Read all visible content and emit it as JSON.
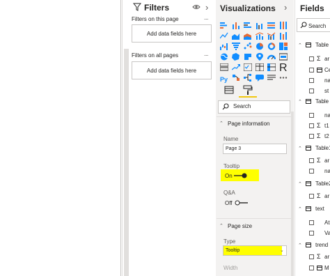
{
  "filters": {
    "title": "Filters",
    "page_section": "Filters on this page",
    "page_well": "Add data fields here",
    "all_section": "Filters on all pages",
    "all_well": "Add data fields here",
    "more": "...",
    "collapse": "›"
  },
  "visualizations": {
    "title": "Visualizations",
    "collapse": "›",
    "search_placeholder": "Search",
    "icon_letters": [
      "R",
      "Py"
    ],
    "page_information": {
      "header": "Page information",
      "name_label": "Name",
      "name_value": "Page 3",
      "tooltip_label": "Tooltip",
      "tooltip_value": "On",
      "qa_label": "Q&A",
      "qa_value": "Off"
    },
    "page_size": {
      "header": "Page size",
      "type_label": "Type",
      "type_value": "Tooltip",
      "width_label": "Width"
    },
    "colors": {
      "accent": "#f2c811",
      "highlight": "#ffff00"
    }
  },
  "fields": {
    "title": "Fields",
    "search_placeholder": "Search",
    "items": [
      {
        "text": "Table",
        "kind": "table"
      },
      {
        "text": "ar",
        "kind": "sigma"
      },
      {
        "text": "Ce",
        "kind": "calc"
      },
      {
        "text": "na",
        "kind": "field"
      },
      {
        "text": "st",
        "kind": "field"
      },
      {
        "text": "Table",
        "kind": "table"
      },
      {
        "text": "na",
        "kind": "field"
      },
      {
        "text": "t1",
        "kind": "sigma"
      },
      {
        "text": "t2",
        "kind": "sigma"
      },
      {
        "text": "Table1",
        "kind": "table"
      },
      {
        "text": "ar",
        "kind": "sigma"
      },
      {
        "text": "na",
        "kind": "field"
      },
      {
        "text": "Table2",
        "kind": "table"
      },
      {
        "text": "ar",
        "kind": "sigma"
      },
      {
        "text": "text",
        "kind": "table"
      },
      {
        "text": "At",
        "kind": "field"
      },
      {
        "text": "Va",
        "kind": "field"
      },
      {
        "text": "trend",
        "kind": "table"
      },
      {
        "text": "ar",
        "kind": "sigma"
      },
      {
        "text": "M",
        "kind": "calc"
      }
    ]
  }
}
